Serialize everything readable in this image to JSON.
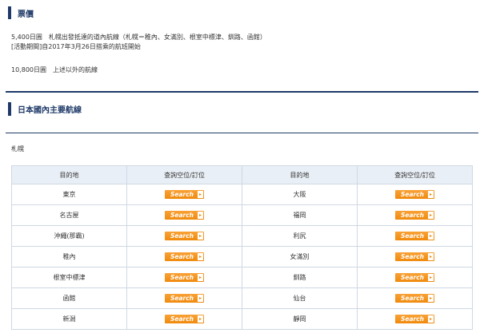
{
  "price_section": {
    "title": "票價",
    "line1": "5,400日圓　札幌出發抵達的道內航線（札幌＝稚內、女滿別、根室中標津、釧路、函館）",
    "line2": "[活動期間]自2017年3月26日搭乘的航班開始",
    "line3": "10,800日圓　上述以外的航線"
  },
  "routes_section": {
    "title": "日本國內主要航線",
    "origin": "札幌"
  },
  "table": {
    "headers": [
      "目的地",
      "查詢空位/訂位",
      "目的地",
      "查詢空位/訂位"
    ],
    "search_label": "Search",
    "rows": [
      {
        "left": "東京",
        "right": "大阪"
      },
      {
        "left": "名古屋",
        "right": "福岡"
      },
      {
        "left": "沖繩(那霸)",
        "right": "利尻"
      },
      {
        "left": "稚內",
        "right": "女滿別"
      },
      {
        "left": "根室中標津",
        "right": "釧路"
      },
      {
        "left": "函館",
        "right": "仙台"
      },
      {
        "left": "新潟",
        "right": "靜岡"
      }
    ]
  },
  "colors": {
    "accent_navy": "#1f3a68",
    "button_orange": "#f08a0c",
    "header_bg": "#e9eff6"
  },
  "icons": {
    "button_arrow": "chevron-right-icon"
  }
}
